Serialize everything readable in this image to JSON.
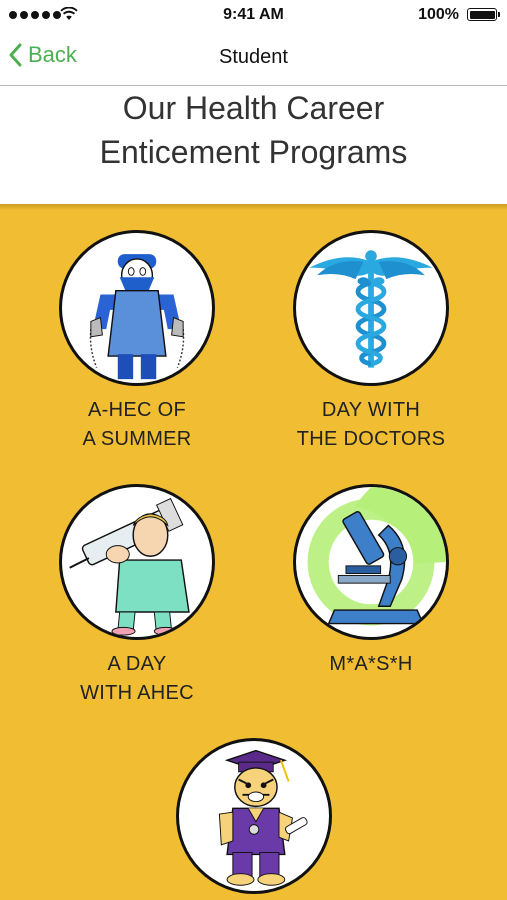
{
  "status_bar": {
    "time": "9:41 AM",
    "battery": "100%"
  },
  "nav": {
    "back_label": "Back",
    "title": "Student"
  },
  "header": {
    "title_line1": "Our Health Career",
    "title_line2": "Enticement Programs"
  },
  "programs": [
    {
      "line1": "A-HEC OF",
      "line2": "A SUMMER",
      "icon": "surgeon-icon"
    },
    {
      "line1": "DAY WITH",
      "line2": "THE DOCTORS",
      "icon": "caduceus-icon"
    },
    {
      "line1": "A DAY",
      "line2": "WITH AHEC",
      "icon": "nurse-syringe-icon"
    },
    {
      "line1": "M*A*S*H",
      "line2": "",
      "icon": "microscope-icon"
    },
    {
      "line1": "",
      "line2": "",
      "icon": "tiger-mascot-icon"
    }
  ],
  "colors": {
    "background": "#f0bd33",
    "accent": "#4caf50"
  }
}
